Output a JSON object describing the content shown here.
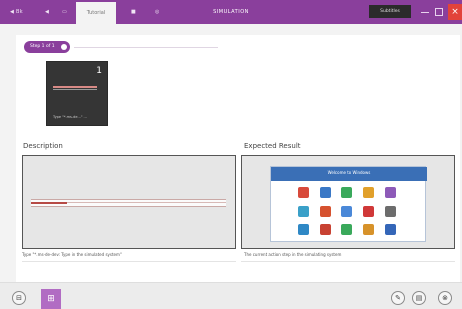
{
  "titlebar": {
    "left_items": [
      "◀ Bk",
      "◀",
      "▭"
    ],
    "active_tab": "Tutorial",
    "tabs_after": [
      "■",
      "◎"
    ],
    "title": "SIMULATION",
    "dark_button": "Subtitles",
    "close_icon": "×"
  },
  "tag": {
    "label": "Step 1 of 1"
  },
  "thumbnail": {
    "number": "1",
    "caption": "Type \"*.ms-de...\" ..."
  },
  "description": {
    "label": "Description",
    "caption": "Type \"*.ms-de-dev: Type in the simulated system\""
  },
  "expected": {
    "label": "Expected Result",
    "caption": "The current action step in the simulating system",
    "browser_title": "Welcome to Windows"
  },
  "bottombar": {
    "left_icon": "⊟",
    "active_icon": "⊞",
    "right_icons": [
      "✎",
      "▤",
      "⊗"
    ]
  },
  "colors": {
    "accent": "#8a3f9c",
    "close": "#e2433a",
    "app_icons": [
      "#d84a3b",
      "#3a78c6",
      "#3aa95b",
      "#e1a02b",
      "#8d5ab8",
      "#3aa0c8",
      "#d6522f",
      "#4a88d8",
      "#d03838",
      "#6c6c6c",
      "#2f88c5",
      "#c84232",
      "#3aa95b",
      "#d7922a",
      "#3466b8"
    ]
  }
}
